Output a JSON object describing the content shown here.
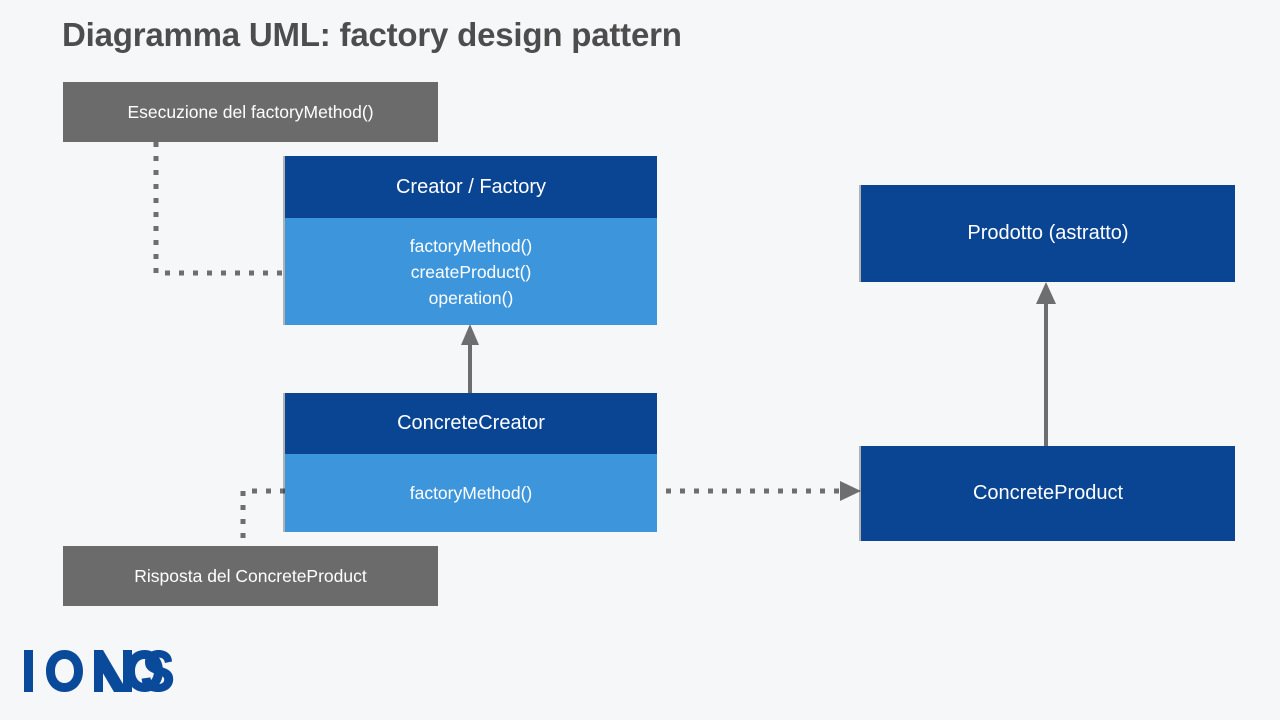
{
  "page": {
    "title": "Diagramma UML: factory design pattern",
    "background_color": "#f6f7f9",
    "title_color": "#4d4d4d"
  },
  "palette": {
    "class_header": "#0a4593",
    "class_body": "#3d95dc",
    "note": "#6b6b6b",
    "connector": "#6e6e6e",
    "logo": "#0a4a9b"
  },
  "notes": [
    {
      "id": "note-top",
      "text": "Esecuzione del factoryMethod()"
    },
    {
      "id": "note-bottom",
      "text": "Risposta del ConcreteProduct"
    }
  ],
  "classes": {
    "creator": {
      "name": "Creator / Factory",
      "methods": [
        "factoryMethod()",
        "createProduct()",
        "operation()"
      ]
    },
    "concrete_creator": {
      "name": "ConcreteCreator",
      "methods": [
        "factoryMethod()"
      ]
    },
    "product": {
      "name": "Prodotto (astratto)"
    },
    "concrete_product": {
      "name": "ConcreteProduct"
    }
  },
  "connectors": [
    {
      "id": "note-top-to-creator",
      "style": "dotted",
      "arrowhead": "none",
      "from": "note-top",
      "to": "creator"
    },
    {
      "id": "concrete-creator-to-creator",
      "style": "solid",
      "arrowhead": "triangle-up",
      "from": "concrete_creator",
      "to": "creator"
    },
    {
      "id": "concrete-creator-to-note-bottom",
      "style": "dotted",
      "arrowhead": "none",
      "from": "concrete_creator",
      "to": "note-bottom"
    },
    {
      "id": "concrete-creator-to-concrete-product",
      "style": "dotted",
      "arrowhead": "triangle-right",
      "from": "concrete_creator",
      "to": "concrete_product"
    },
    {
      "id": "concrete-product-to-product",
      "style": "solid",
      "arrowhead": "triangle-up",
      "from": "concrete_product",
      "to": "product"
    }
  ],
  "logo": {
    "text": "IONOS"
  }
}
